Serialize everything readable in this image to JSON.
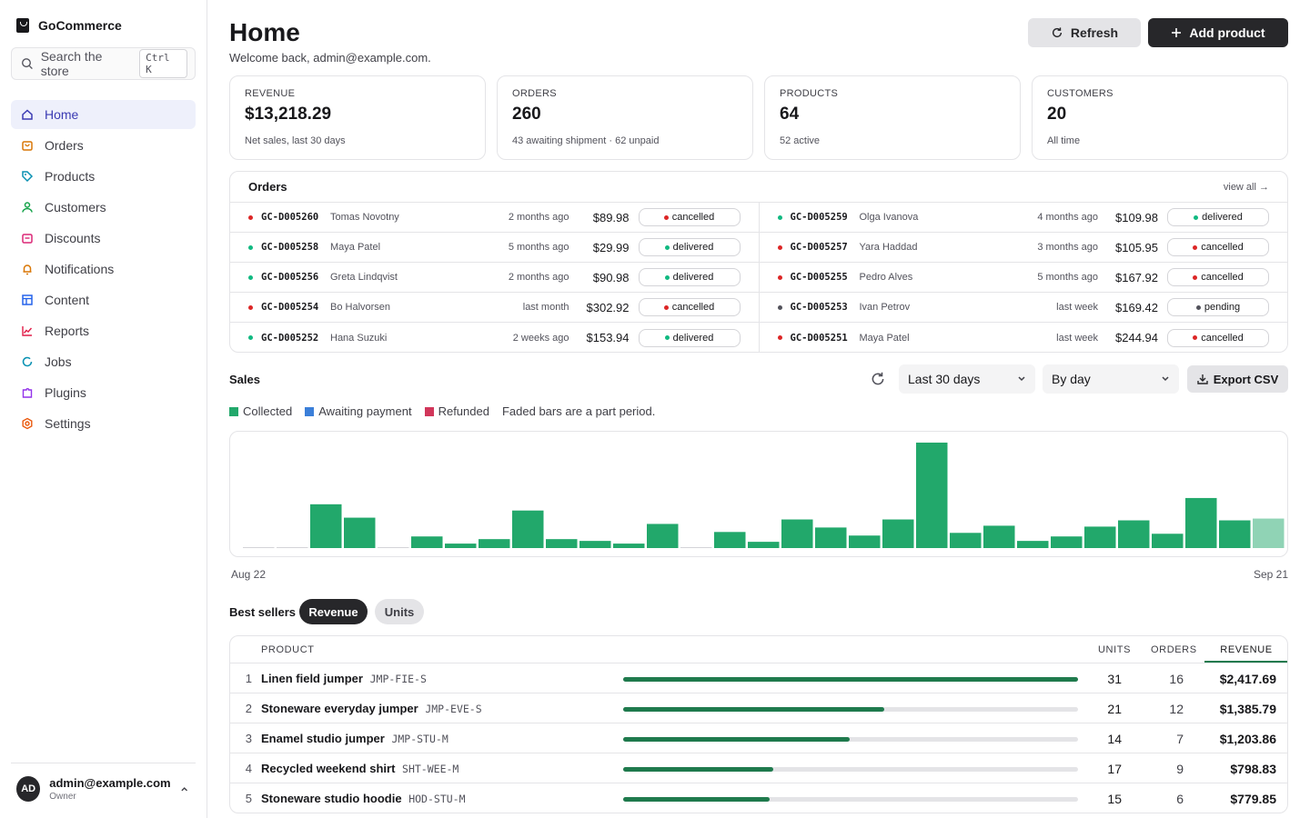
{
  "sidebar": {
    "brand": "GoCommerce",
    "search": {
      "placeholder": "Search the store",
      "shortcut": "Ctrl K"
    },
    "items": [
      {
        "label": "Home",
        "icon": "home-icon",
        "color": "#3b3bb3",
        "active": true
      },
      {
        "label": "Orders",
        "icon": "bag-icon",
        "color": "#d97706"
      },
      {
        "label": "Products",
        "icon": "tag-icon",
        "color": "#0891b2"
      },
      {
        "label": "Customers",
        "icon": "user-icon",
        "color": "#16a34a"
      },
      {
        "label": "Discounts",
        "icon": "ticket-icon",
        "color": "#db2777"
      },
      {
        "label": "Notifications",
        "icon": "bell-icon",
        "color": "#d97706"
      },
      {
        "label": "Content",
        "icon": "layout-icon",
        "color": "#2563eb"
      },
      {
        "label": "Reports",
        "icon": "chart-icon",
        "color": "#e11d48"
      },
      {
        "label": "Jobs",
        "icon": "spinner-icon",
        "color": "#0891b2"
      },
      {
        "label": "Plugins",
        "icon": "puzzle-icon",
        "color": "#9333ea"
      },
      {
        "label": "Settings",
        "icon": "gear-icon",
        "color": "#ea580c"
      }
    ],
    "user": {
      "initials": "AD",
      "email": "admin@example.com",
      "role": "Owner"
    }
  },
  "header": {
    "title": "Home",
    "subtitle": "Welcome back, admin@example.com.",
    "refresh_label": "Refresh",
    "add_label": "Add product"
  },
  "stats": [
    {
      "label": "REVENUE",
      "value": "$13,218.29",
      "note": "Net sales, last 30 days"
    },
    {
      "label": "ORDERS",
      "value": "260",
      "note": "43 awaiting shipment · 62 unpaid"
    },
    {
      "label": "PRODUCTS",
      "value": "64",
      "note": "52 active"
    },
    {
      "label": "CUSTOMERS",
      "value": "20",
      "note": "All time"
    }
  ],
  "orders": {
    "title": "Orders",
    "view_all": "view all →",
    "left": [
      {
        "id": "GC-D005260",
        "customer": "Tomas Novotny",
        "time": "2 months ago",
        "amount": "$89.98",
        "status": "cancelled"
      },
      {
        "id": "GC-D005258",
        "customer": "Maya Patel",
        "time": "5 months ago",
        "amount": "$29.99",
        "status": "delivered"
      },
      {
        "id": "GC-D005256",
        "customer": "Greta Lindqvist",
        "time": "2 months ago",
        "amount": "$90.98",
        "status": "delivered"
      },
      {
        "id": "GC-D005254",
        "customer": "Bo Halvorsen",
        "time": "last month",
        "amount": "$302.92",
        "status": "cancelled"
      },
      {
        "id": "GC-D005252",
        "customer": "Hana Suzuki",
        "time": "2 weeks ago",
        "amount": "$153.94",
        "status": "delivered"
      }
    ],
    "right": [
      {
        "id": "GC-D005259",
        "customer": "Olga Ivanova",
        "time": "4 months ago",
        "amount": "$109.98",
        "status": "delivered"
      },
      {
        "id": "GC-D005257",
        "customer": "Yara Haddad",
        "time": "3 months ago",
        "amount": "$105.95",
        "status": "cancelled"
      },
      {
        "id": "GC-D005255",
        "customer": "Pedro Alves",
        "time": "5 months ago",
        "amount": "$167.92",
        "status": "cancelled"
      },
      {
        "id": "GC-D005253",
        "customer": "Ivan Petrov",
        "time": "last week",
        "amount": "$169.42",
        "status": "pending"
      },
      {
        "id": "GC-D005251",
        "customer": "Maya Patel",
        "time": "last week",
        "amount": "$244.94",
        "status": "cancelled"
      }
    ],
    "status_colors": {
      "cancelled": "#dc2626",
      "delivered": "#10b981",
      "pending": "#52525b"
    }
  },
  "sales": {
    "title": "Sales",
    "range": "Last 30 days",
    "group": "By day",
    "export_label": "Export CSV",
    "legend": [
      {
        "label": "Collected",
        "color": "#22a86b"
      },
      {
        "label": "Awaiting payment",
        "color": "#3b7fd9"
      },
      {
        "label": "Refunded",
        "color": "#d1365a"
      }
    ],
    "note": "Faded bars are a part period.",
    "x_start": "Aug 22",
    "x_end": "Sep 21"
  },
  "chart_data": {
    "type": "bar",
    "categories": [
      "Aug 22",
      "",
      "",
      "",
      "",
      "",
      "",
      "",
      "",
      "",
      "",
      "",
      "",
      "",
      "",
      "",
      "",
      "",
      "",
      "",
      "",
      "",
      "",
      "",
      "",
      "",
      "",
      "",
      "",
      "",
      "Sep 21"
    ],
    "series": [
      {
        "name": "Collected",
        "values": [
          0,
          0,
          245,
          170,
          0,
          65,
          25,
          50,
          210,
          50,
          40,
          25,
          135,
          0,
          90,
          35,
          160,
          115,
          70,
          160,
          590,
          85,
          125,
          40,
          65,
          120,
          155,
          80,
          280,
          155,
          165
        ]
      }
    ],
    "partial_last": true,
    "ylim": [
      0,
      600
    ]
  },
  "bestsellers": {
    "title": "Best sellers",
    "tab_revenue": "Revenue",
    "tab_units": "Units",
    "headers": {
      "product": "PRODUCT",
      "units": "UNITS",
      "orders": "ORDERS",
      "revenue": "REVENUE"
    },
    "rows": [
      {
        "rank": "1",
        "name": "Linen field jumper",
        "sku": "JMP-FIE-S",
        "units": "31",
        "orders": "16",
        "revenue": "$2,417.69",
        "share": 1.0
      },
      {
        "rank": "2",
        "name": "Stoneware everyday jumper",
        "sku": "JMP-EVE-S",
        "units": "21",
        "orders": "12",
        "revenue": "$1,385.79",
        "share": 0.573
      },
      {
        "rank": "3",
        "name": "Enamel studio jumper",
        "sku": "JMP-STU-M",
        "units": "14",
        "orders": "7",
        "revenue": "$1,203.86",
        "share": 0.498
      },
      {
        "rank": "4",
        "name": "Recycled weekend shirt",
        "sku": "SHT-WEE-M",
        "units": "17",
        "orders": "9",
        "revenue": "$798.83",
        "share": 0.33
      },
      {
        "rank": "5",
        "name": "Stoneware studio hoodie",
        "sku": "HOD-STU-M",
        "units": "15",
        "orders": "6",
        "revenue": "$779.85",
        "share": 0.322
      }
    ]
  }
}
